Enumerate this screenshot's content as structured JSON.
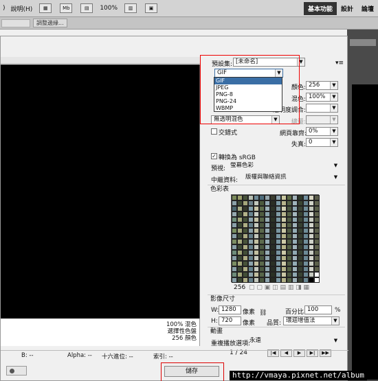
{
  "menubar": {
    "help_label": "說明(H)",
    "zoom_label": "100%",
    "workspaces": [
      "基本功能",
      "設計",
      "論壇"
    ]
  },
  "optbar": {
    "adjust_edge_label": "調整邊緣..."
  },
  "settings": {
    "preset_label": "預設集:",
    "preset_value": "[未命名]",
    "format_value": "GIF",
    "format_options": [
      "GIF",
      "JPEG",
      "PNG-8",
      "PNG-24",
      "WBMP"
    ],
    "colors_label": "顏色:",
    "colors_value": "256",
    "dither_label": "混色:",
    "dither_value": "100%",
    "matte_label": "透明度調合:",
    "matte_value": "",
    "trans_dither_value": "無透明混色",
    "amount_label": "總量:",
    "interlaced_label": "交錯式",
    "web_snap_label": "網頁靠齊:",
    "web_snap_value": "0%",
    "lossy_label": "失真:",
    "lossy_value": "0",
    "convert_srgb_label": "轉換為 sRGB",
    "preview_label": "預視:",
    "preview_value": "螢幕色彩",
    "metadata_label": "中繼資料:",
    "metadata_value": "版權與聯絡資訊"
  },
  "color_table": {
    "title": "色彩表",
    "count": "256",
    "colors": [
      "#7a8a5a",
      "#9a9f6c",
      "#47523a",
      "#b7c0b3",
      "#6f8a96",
      "#4d6b7a",
      "#94a5ab",
      "#3b3d2f",
      "#8da3ae",
      "#c9c8a0",
      "#5c6b46",
      "#a2b2b9",
      "#2f3a2b",
      "#718f9e",
      "#d8d6c2",
      "#5a5c4a",
      "#8aa0a8",
      "#3e4a35",
      "#a3a57a",
      "#6b7f88",
      "#c2c7bc",
      "#4c5a3d",
      "#93a9b3",
      "#2b2e24",
      "#7c9aa6",
      "#b8b48c",
      "#556245",
      "#9fb4bc",
      "#3a4533",
      "#6a8794",
      "#cfd2c7",
      "#60644e",
      "#4d6870",
      "#a9ae86",
      "#35392c",
      "#82a0ab",
      "#c6c3a4",
      "#5e6d4c",
      "#9bb0b8",
      "#2e3428",
      "#768f99",
      "#d1cfb3",
      "#4a5640",
      "#8ea7b1",
      "#3c4637",
      "#6e8c98",
      "#bfc4b8",
      "#585f49",
      "#95a8af",
      "#3f4b36",
      "#b2b18a",
      "#68838e",
      "#c9cdc3",
      "#4f5c40",
      "#8aa3ad",
      "#29302a",
      "#809da8",
      "#bab890",
      "#576347",
      "#a5b7be",
      "#384232",
      "#6c8a96",
      "#d6d8cf",
      "#5d614b",
      "#6f8f7a",
      "#a1a678",
      "#434f38",
      "#8fa6ae",
      "#c3c0a2",
      "#59684a",
      "#97adb5",
      "#2c3226",
      "#7895a0",
      "#cdcaa8",
      "#4e5a42",
      "#91aab3",
      "#3b4535",
      "#6d8b97",
      "#c8ccc2",
      "#5b604a",
      "#8ba1a9",
      "#3d4934",
      "#aeae84",
      "#65808b",
      "#c5c9be",
      "#4b5840",
      "#90a6af",
      "#282d24",
      "#7d9ba6",
      "#b6b48b",
      "#546044",
      "#a0b3ba",
      "#363f30",
      "#6b8894",
      "#d2d4cb",
      "#5f634c",
      "#798f60",
      "#a5a97c",
      "#465137",
      "#8ca3ab",
      "#c0bd9e",
      "#5b694b",
      "#95abb3",
      "#2a2f24",
      "#7996a1",
      "#cbc8a5",
      "#4f5b42",
      "#93abb4",
      "#3a4434",
      "#6f8d99",
      "#cbcec5",
      "#5c614b",
      "#889ea6",
      "#3c4834",
      "#abab82",
      "#637e89",
      "#c2c6bb",
      "#49563f",
      "#8ea4ad",
      "#272c23",
      "#7b98a3",
      "#b4b288",
      "#526043",
      "#9eb1b8",
      "#353e2f",
      "#698692",
      "#d0d2c9",
      "#5d614b",
      "#7b8d63",
      "#a7ab7e",
      "#48533a",
      "#8ea5ad",
      "#c2bfa0",
      "#5d6b4d",
      "#97adb5",
      "#2c3126",
      "#7b98a3",
      "#cdcaa7",
      "#515d44",
      "#95adb6",
      "#3c4636",
      "#718f9b",
      "#cdd0c7",
      "#5e634d",
      "#8aa0a8",
      "#3e4a36",
      "#adad84",
      "#65808b",
      "#c4c8bd",
      "#4b5841",
      "#90a6af",
      "#292e25",
      "#7d9aa5",
      "#b6b48a",
      "#546245",
      "#a0b3ba",
      "#374031",
      "#6b8894",
      "#d2d4cb",
      "#5f634d",
      "#6e8c7a",
      "#a0a577",
      "#424e37",
      "#8ea5ad",
      "#c2bfa1",
      "#58674a",
      "#96acb4",
      "#2b3125",
      "#7794a0",
      "#ccc9a7",
      "#4d5941",
      "#90a9b2",
      "#3a4434",
      "#6c8a96",
      "#c7cbc1",
      "#5a5f49",
      "#8a9fa7",
      "#3c4834",
      "#adac83",
      "#647f8a",
      "#c4c8bd",
      "#4a573f",
      "#8fa5ae",
      "#272c23",
      "#7c99a4",
      "#b5b389",
      "#536043",
      "#9fb2b9",
      "#363f30",
      "#6a8793",
      "#d1d3ca",
      "#5e624c",
      "#7a8d62",
      "#a6aa7d",
      "#475239",
      "#8da4ac",
      "#c1be9f",
      "#5c6a4c",
      "#96acb4",
      "#2b3025",
      "#7a97a2",
      "#ccc9a6",
      "#505c43",
      "#94acb5",
      "#3b4535",
      "#708e9a",
      "#ccd0c6",
      "#5d624c",
      "#89a0a8",
      "#3d4935",
      "#acac83",
      "#64818b",
      "#c3c7bc",
      "#4a5740",
      "#8fa5ae",
      "#282d24",
      "#7c99a4",
      "#b5b389",
      "#536144",
      "#9fb2b9",
      "#363f30",
      "#6a8793",
      "#d1d3ca",
      "#5e624c",
      "#6d8b79",
      "#9fa476",
      "#414d36",
      "#8da4ac",
      "#c1bea0",
      "#576649",
      "#95abb3",
      "#2a3024",
      "#76939f",
      "#cbc8a6",
      "#4c5840",
      "#8fa8b1",
      "#394333",
      "#6b8995",
      "#c6cac0",
      "#ffffff",
      "#89a0a8",
      "#3b4733",
      "#acab82",
      "#637e89",
      "#c3c7bc",
      "#49563f",
      "#8ea4ad",
      "#262b22",
      "#7b98a3",
      "#b4b288",
      "#526043",
      "#9eb1b8",
      "#353e2f",
      "#698692",
      "#000000",
      "#ffffff"
    ]
  },
  "image_size": {
    "title": "影像尺寸",
    "w_label": "W:",
    "w_value": "1280",
    "h_label": "H:",
    "h_value": "720",
    "unit": "像素",
    "percent_label": "百分比:",
    "percent_value": "100",
    "percent_unit": "%",
    "quality_label": "品質:",
    "quality_value": "環迴增值法"
  },
  "animation": {
    "title": "動畫",
    "loop_label": "重複播放選項:",
    "loop_value": "永遠",
    "frame_counter": "1 / 24"
  },
  "preview_info": {
    "line1": "100% 混色",
    "line2": "選擇性色盤",
    "line3": "256 顏色"
  },
  "status": {
    "b_label": "B: --",
    "alpha_label": "Alpha: --",
    "hex_label": "十六進位: --",
    "index_label": "索引: --"
  },
  "buttons": {
    "save_label": "儲存"
  },
  "watermark": "http://vmaya.pixnet.net/album"
}
